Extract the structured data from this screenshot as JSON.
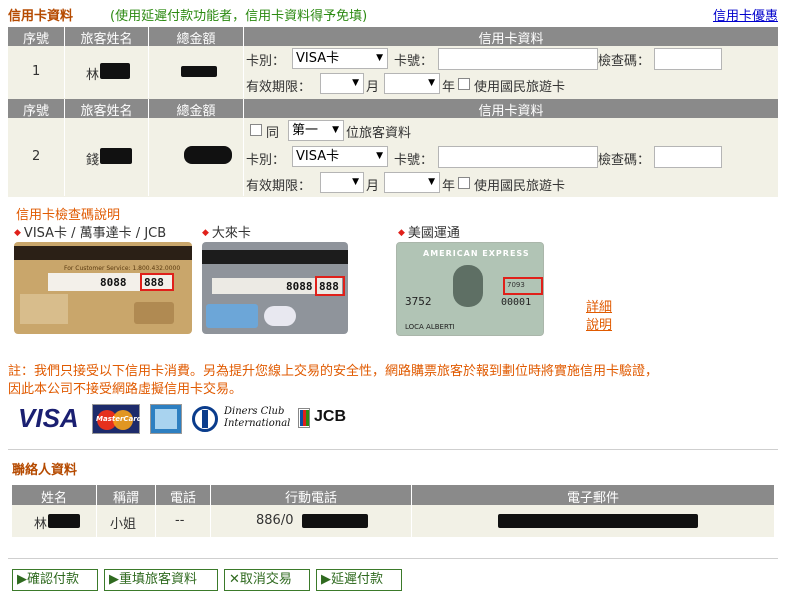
{
  "header": {
    "title": "信用卡資料",
    "note": "(使用延遲付款功能者，信用卡資料得予免填)",
    "offer_link": "信用卡優惠"
  },
  "cc_table": {
    "columns": [
      "序號",
      "旅客姓名",
      "總金額",
      "信用卡資料"
    ],
    "rows": [
      {
        "seq": "1",
        "name": "林",
        "card_type_label": "卡別：",
        "card_type_value": "VISA卡",
        "card_no_label": "卡號：",
        "check_code_label": "檢查碼：",
        "expiry_label": "有效期限：",
        "month_label": "月",
        "year_label": "年",
        "travel_card_label": "使用國民旅遊卡"
      },
      {
        "seq": "2",
        "name": "錢",
        "same_label": "同",
        "same_value": "第一",
        "same_suffix": "位旅客資料",
        "card_type_label": "卡別：",
        "card_type_value": "VISA卡",
        "card_no_label": "卡號：",
        "check_code_label": "檢查碼：",
        "expiry_label": "有效期限：",
        "month_label": "月",
        "year_label": "年",
        "travel_card_label": "使用國民旅遊卡"
      }
    ]
  },
  "cvv": {
    "title": "信用卡檢查碼說明",
    "cards": [
      {
        "label": "VISA卡 / 萬事達卡 / JCB",
        "number": "8088",
        "code": "888",
        "band_text": "For Customer Service: 1.800.432.0000"
      },
      {
        "label": "大來卡",
        "number": "8088",
        "code": "888"
      },
      {
        "label": "美國運通",
        "brand": "AMERICAN EXPRESS",
        "number": "3752",
        "number2": "00001",
        "code": "7093",
        "name": "LOCA ALBERTI"
      }
    ],
    "detail_link_1": "詳細",
    "detail_link_2": "說明"
  },
  "notice": {
    "line1": "註：我們只接受以下信用卡消費。另為提升您線上交易的安全性，網路購票旅客於報到劃位時將實施信用卡驗證，",
    "line2": "因此本公司不接受網路虛擬信用卡交易。"
  },
  "logos": {
    "visa": "VISA",
    "mastercard": "MasterCard",
    "diners_1": "Diners Club",
    "diners_2": "International",
    "jcb": "JCB"
  },
  "contact": {
    "title": "聯絡人資料",
    "columns": [
      "姓名",
      "稱謂",
      "電話",
      "行動電話",
      "電子郵件"
    ],
    "row": {
      "name": "林",
      "title": "小姐",
      "phone": "--",
      "mobile": "886/0"
    }
  },
  "buttons": {
    "confirm": "確認付款",
    "refill": "重填旅客資料",
    "cancel": "取消交易",
    "delay": "延遲付款"
  },
  "colors": {
    "header_bg": "#8a8a8a",
    "row_bg": "#f2f1e6",
    "title_brown": "#b54a00",
    "note_green": "#2c8a12",
    "notice_orange": "#e05a00",
    "link_blue": "#0000cc"
  }
}
